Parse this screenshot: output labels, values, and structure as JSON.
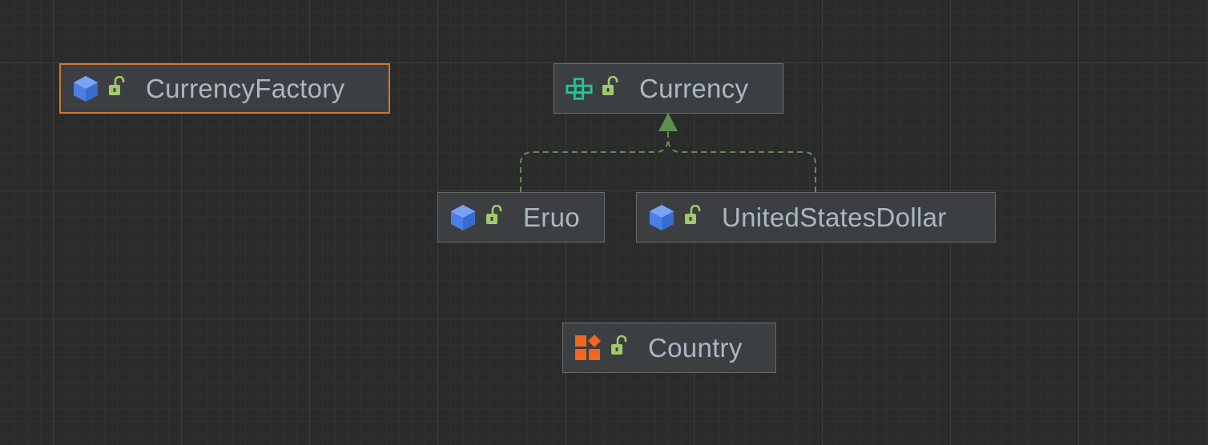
{
  "diagram": {
    "nodes": [
      {
        "id": "currency-factory",
        "label": "CurrencyFactory",
        "kind": "class",
        "visibility": "public",
        "selected": true
      },
      {
        "id": "currency",
        "label": "Currency",
        "kind": "interface",
        "visibility": "public",
        "selected": false
      },
      {
        "id": "eruo",
        "label": "Eruo",
        "kind": "class",
        "visibility": "public",
        "selected": false
      },
      {
        "id": "united-states-dollar",
        "label": "UnitedStatesDollar",
        "kind": "class",
        "visibility": "public",
        "selected": false
      },
      {
        "id": "country",
        "label": "Country",
        "kind": "enum",
        "visibility": "public",
        "selected": false
      }
    ],
    "edges": [
      {
        "from": "eruo",
        "to": "currency",
        "type": "implements"
      },
      {
        "from": "united-states-dollar",
        "to": "currency",
        "type": "implements"
      }
    ]
  },
  "colors": {
    "background": "#2b2b2b",
    "node_fill": "#3c3f41",
    "node_border": "#6b6b6b",
    "selected_border": "#cc7832",
    "label": "#a9b7c6",
    "class_icon": "#4a7fe6",
    "interface_icon": "#1fc59a",
    "enum_icon": "#f26522",
    "lock_icon": "#a3c86b",
    "edge": "#5f8f4e"
  }
}
